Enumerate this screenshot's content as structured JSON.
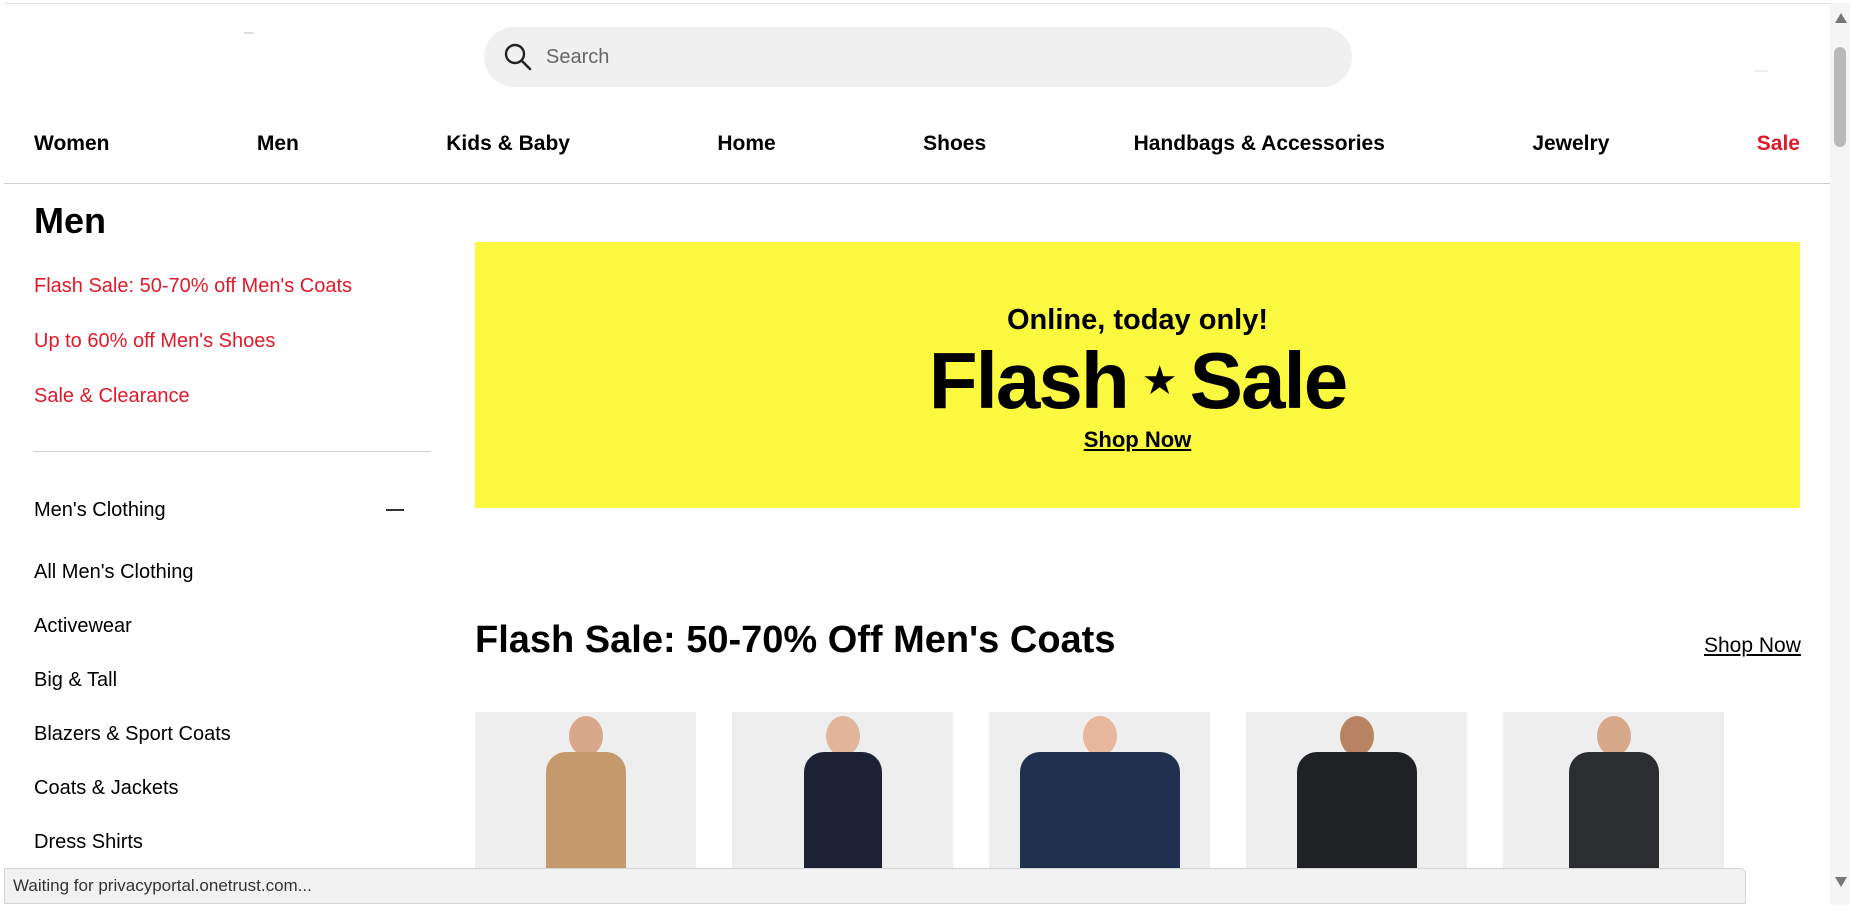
{
  "header": {
    "search_placeholder": "Search"
  },
  "topnav": {
    "items": [
      "Women",
      "Men",
      "Kids & Baby",
      "Home",
      "Shoes",
      "Handbags & Accessories",
      "Jewelry",
      "Sale"
    ]
  },
  "sidebar": {
    "title": "Men",
    "promos": [
      "Flash Sale: 50-70% off Men's Coats",
      "Up to 60% off Men's Shoes",
      "Sale & Clearance"
    ],
    "section": "Men's Clothing",
    "items": [
      "All Men's Clothing",
      "Activewear",
      "Big & Tall",
      "Blazers & Sport Coats",
      "Coats & Jackets",
      "Dress Shirts"
    ]
  },
  "hero": {
    "kicker": "Online, today only!",
    "title_left": "Flash",
    "star": "★",
    "title_right": "Sale",
    "cta": "Shop Now",
    "bg_color": "#fbf93f"
  },
  "section": {
    "title": "Flash Sale: 50-70% Off Men's Coats",
    "link": "Shop Now"
  },
  "products": [
    {
      "coat": "#c49a6c",
      "head": "#d9a88a"
    },
    {
      "coat": "#1c2233",
      "head": "#e0b59a"
    },
    {
      "coat": "#22304f",
      "head": "#e6b79c"
    },
    {
      "coat": "#1f2125",
      "head": "#b88463"
    },
    {
      "coat": "#2c2d30",
      "head": "#d6a98a"
    }
  ],
  "status": {
    "text": "Waiting for privacyportal.onetrust.com..."
  },
  "colors": {
    "accent_red": "#e01a2b"
  }
}
